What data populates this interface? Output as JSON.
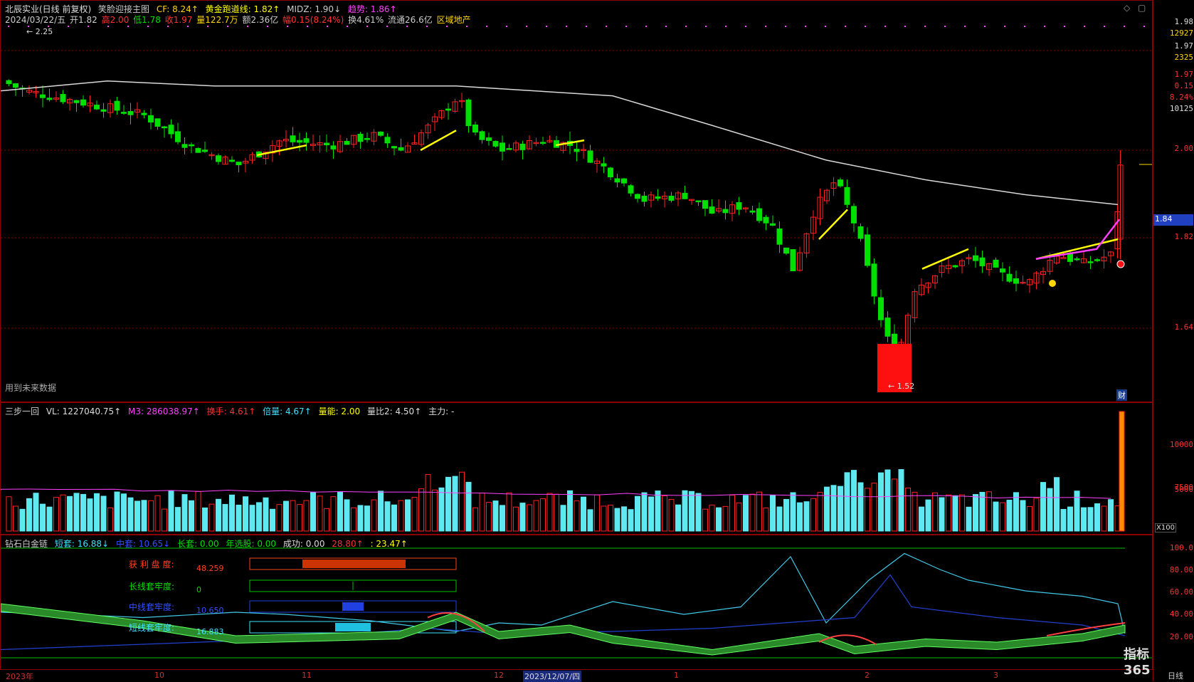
{
  "main_header": {
    "stock": "北辰实业(日线 前复权)",
    "indicator_name": "笑脸迎接主图",
    "cf": "CF: 8.24↑",
    "golden_track": "黄金跑道线: 1.82↑",
    "midz": "MIDZ: 1.90↓",
    "trend": "趋势: 1.86↑",
    "date": "2024/03/22/五",
    "open": "开1.82",
    "high": "高2.00",
    "low": "低1.78",
    "close": "收1.97",
    "volume": "量122.7万",
    "amount": "额2.36亿",
    "change": "幅0.15(8.24%)",
    "turnover": "换4.61%",
    "float": "流通26.6亿",
    "sector": "区域地产",
    "future_note": "用到未来数据",
    "high_mark": "2.25",
    "low_mark": "1.52",
    "cai_badge": "财"
  },
  "right_info": {
    "price1": "1.98",
    "vol1": "12927",
    "price2": "1.97",
    "vol2": "2325",
    "last": "1.97",
    "chg": "0.15",
    "pct": "8.24%",
    "vol3": "10125",
    "cursor_price": "1.84"
  },
  "price_axis": [
    "2.00",
    "1.82",
    "1.64"
  ],
  "vol_header": {
    "name": "三步一回",
    "vl": "VL: 1227040.75↑",
    "m3": "M3: 286038.97↑",
    "turnover": "换手: 4.61↑",
    "multiple": "倍量: 4.67↑",
    "energy": "量能: 2.00",
    "ratio": "量比2: 4.50↑",
    "main": "主力: -"
  },
  "vol_axis": [
    "10000",
    "7500",
    "5000"
  ],
  "vol_unit": "X100",
  "ind_header": {
    "name": "钻石白金链",
    "short": "短套: 16.88↓",
    "mid": "中套: 10.65↓",
    "long": "长套: 0.00",
    "year": "年选股: 0.00",
    "success": "成功: 0.00",
    "v1": "28.80↑",
    "v2": ": 23.47↑"
  },
  "ind_axis": [
    "100.0",
    "80.00",
    "60.00",
    "40.00",
    "20.00"
  ],
  "ind_labels": {
    "profit": "获 利 盘 度:",
    "profit_val": "48.259",
    "long": "长线套牢度:",
    "long_val": "0",
    "mid": "中线套牢度:",
    "mid_val": "10.650",
    "short": "短线套牢度:",
    "short_val": "16.883"
  },
  "date_axis": {
    "year": "2023年",
    "m10": "10",
    "m11": "11",
    "m12": "12",
    "cursor_date": "2023/12/07/四",
    "m1": "1",
    "m2": "2",
    "m3": "3",
    "period": "日线"
  },
  "watermark": "指标365",
  "colors": {
    "up": "#ff2020",
    "down": "#00e000",
    "grid": "#8b0000",
    "ma": "#d8d8d8",
    "vol": "#5ee8f0"
  }
}
